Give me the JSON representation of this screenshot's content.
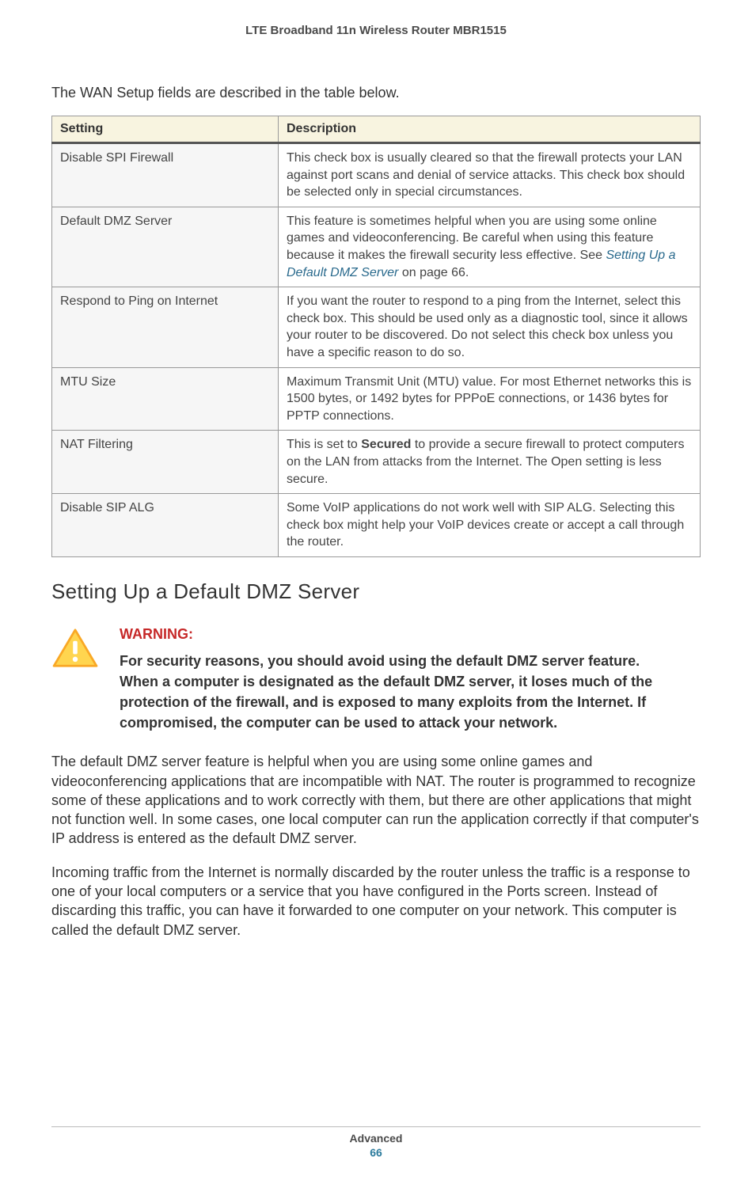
{
  "header": {
    "title": "LTE Broadband 11n Wireless Router MBR1515"
  },
  "intro": "The WAN Setup fields are described in the table below.",
  "table": {
    "head": {
      "col1": "Setting",
      "col2": "Description"
    },
    "rows": [
      {
        "setting": "Disable SPI Firewall",
        "description": "This check box is usually cleared so that the firewall protects your LAN against port scans and denial of service attacks. This check box should be selected only in special circumstances."
      },
      {
        "setting": "Default DMZ Server",
        "desc_before": "This feature is sometimes helpful when you are using some online games and videoconferencing. Be careful when using this feature because it makes the firewall security less effective. See ",
        "link_text": "Setting Up a Default DMZ Server",
        "desc_after": " on page 66."
      },
      {
        "setting": "Respond to Ping on Internet",
        "description": "If you want the router to respond to a ping from the Internet, select this check box. This should be used only as a diagnostic tool, since it allows your router to be discovered. Do not select this check box unless you have a specific reason to do so."
      },
      {
        "setting": "MTU Size",
        "description": "Maximum Transmit Unit (MTU) value. For most Ethernet networks this is 1500 bytes, or 1492 bytes for PPPoE connections, or 1436 bytes for PPTP connections."
      },
      {
        "setting": "NAT Filtering",
        "desc_before": "This is set to ",
        "bold_text": "Secured",
        "desc_after": " to provide a secure firewall to protect computers on the LAN from attacks from the Internet. The Open setting is less secure."
      },
      {
        "setting": "Disable SIP ALG",
        "description": "Some VoIP applications do not work well with SIP ALG. Selecting this check box might help your VoIP devices create or accept a call through the router."
      }
    ]
  },
  "section": {
    "heading": "Setting Up a Default DMZ Server"
  },
  "warning": {
    "label": "WARNING:",
    "body": "For security reasons, you should avoid using the default DMZ server feature. When a computer is designated as the default DMZ server, it loses much of the protection of the firewall, and is exposed to many exploits from the Internet. If compromised, the computer can be used to attack your network."
  },
  "paragraphs": {
    "p1": "The default DMZ server feature is helpful when you are using some online games and videoconferencing applications that are incompatible with NAT. The router is programmed to recognize some of these applications and to work correctly with them, but there are other applications that might not function well. In some cases, one local computer can run the application correctly if that computer's IP address is entered as the default DMZ server.",
    "p2": "Incoming traffic from the Internet is normally discarded by the router unless the traffic is a response to one of your local computers or a service that you have configured in the Ports screen. Instead of discarding this traffic, you can have it forwarded to one computer on your network. This computer is called the default DMZ server."
  },
  "footer": {
    "section": "Advanced",
    "page": "66"
  }
}
